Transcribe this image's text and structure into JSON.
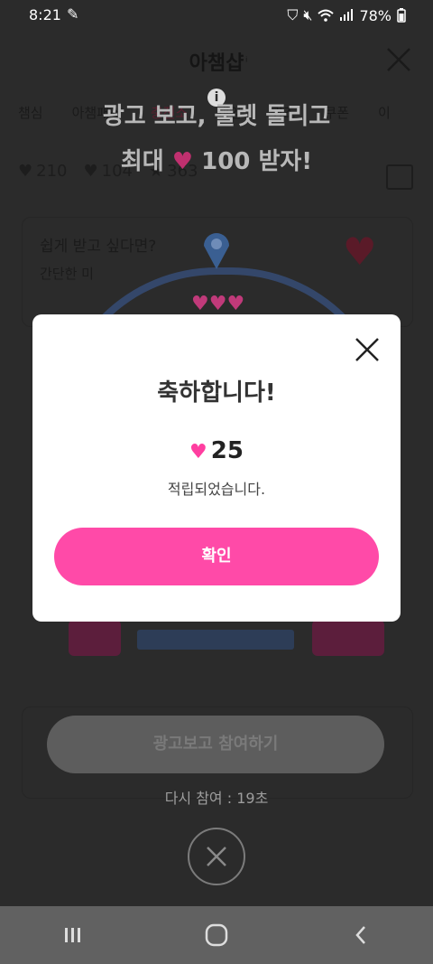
{
  "status": {
    "time": "8:21",
    "battery": "78%"
  },
  "background": {
    "title": "아챔샵",
    "tabs": [
      "챔심",
      "아챔패스",
      "충전소",
      "게임",
      "퀴즈",
      "쿠폰",
      "이"
    ],
    "counts": {
      "hearts": "210",
      "blue": "104",
      "gold": "363"
    },
    "headline_line1": "광고 보고, 룰렛 돌리고",
    "headline_line2_prefix": "최대",
    "headline_line2_suffix": "100 받자!",
    "card1_title": "쉽게 받고 싶다면?",
    "card1_sub": "간단한 미",
    "cta_label": "광고보고 참여하기",
    "retry_text": "다시 참여 : 19초"
  },
  "modal": {
    "title": "축하합니다!",
    "reward_amount": "25",
    "message": "적립되었습니다.",
    "ok_label": "확인"
  },
  "colors": {
    "accent_pink": "#ff4aa8",
    "modal_bg": "#ffffff",
    "overlay": "#2b2b2b"
  },
  "icons": {
    "status": [
      "pencil-icon",
      "shield-icon",
      "mute-icon",
      "wifi-icon",
      "signal-icon",
      "battery-icon"
    ],
    "nav": [
      "recents-icon",
      "home-icon",
      "back-icon"
    ]
  }
}
